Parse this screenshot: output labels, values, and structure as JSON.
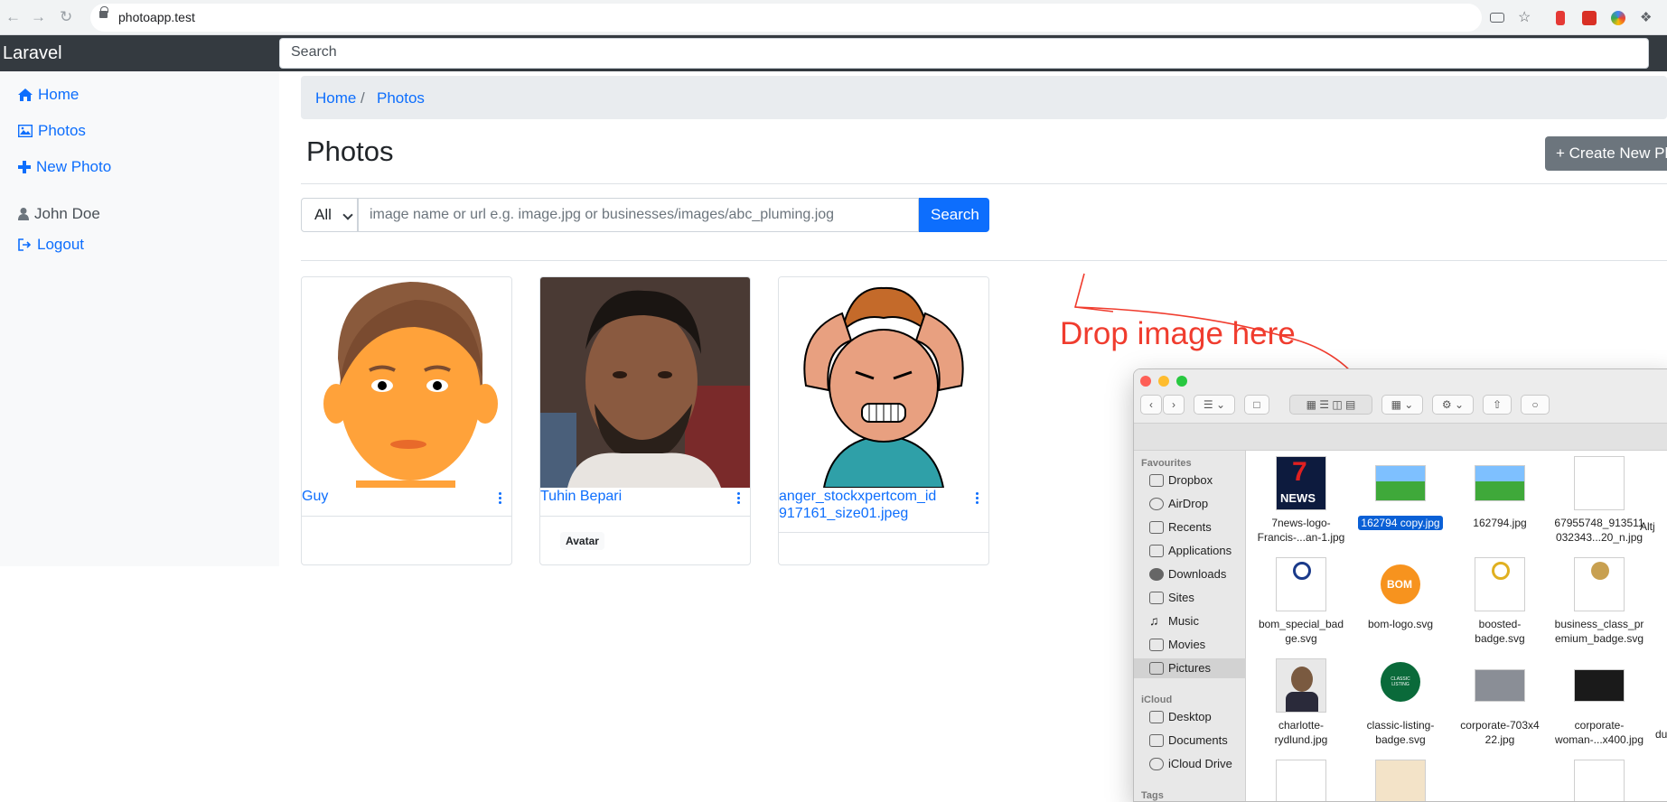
{
  "browser": {
    "url": "photoapp.test"
  },
  "navbar": {
    "brand": "Laravel",
    "search_placeholder": "Search"
  },
  "sidebar": {
    "items": [
      {
        "label": "Home",
        "icon": "home-icon"
      },
      {
        "label": "Photos",
        "icon": "image-icon"
      },
      {
        "label": "New Photo",
        "icon": "plus-icon"
      }
    ],
    "user": "John Doe",
    "logout": "Logout"
  },
  "breadcrumb": {
    "home": "Home",
    "sep": "/",
    "current": "Photos"
  },
  "page": {
    "title": "Photos",
    "create_button": "+ Create New Ph"
  },
  "filter": {
    "type_value": "All",
    "query_placeholder": "image name or url e.g. image.jpg or businesses/images/abc_pluming.jog",
    "search_button": "Search"
  },
  "cards": [
    {
      "name": "Guy",
      "badge": ""
    },
    {
      "name": "Tuhin Bepari",
      "badge": "Avatar"
    },
    {
      "name_line1": "anger_stockxpertcom_id",
      "name_line2": "917161_size01.jpeg",
      "badge": ""
    }
  ],
  "annotation": {
    "drop_text": "Drop image here",
    "color": "#f03c2e"
  },
  "finder": {
    "sidebar": {
      "favourites_header": "Favourites",
      "favourites": [
        "Dropbox",
        "AirDrop",
        "Recents",
        "Applications",
        "Downloads",
        "Sites",
        "Music",
        "Movies",
        "Pictures"
      ],
      "icloud_header": "iCloud",
      "icloud": [
        "Desktop",
        "Documents",
        "iCloud Drive"
      ],
      "tags_header": "Tags"
    },
    "files": [
      {
        "l1": "7news-logo-",
        "l2": "Francis-...an-1.jpg"
      },
      {
        "l1": "162794 copy.jpg",
        "l2": ""
      },
      {
        "l1": "162794.jpg",
        "l2": ""
      },
      {
        "l1": "67955748_913511",
        "l2": "032343...20_n.jpg"
      },
      {
        "l1": "Altj",
        "l2": ""
      },
      {
        "l1": "bom_special_bad",
        "l2": "ge.svg"
      },
      {
        "l1": "bom-logo.svg",
        "l2": ""
      },
      {
        "l1": "boosted-",
        "l2": "badge.svg"
      },
      {
        "l1": "business_class_pr",
        "l2": "emium_badge.svg"
      },
      {
        "l1": "charlotte-",
        "l2": "rydlund.jpg"
      },
      {
        "l1": "classic-listing-",
        "l2": "badge.svg"
      },
      {
        "l1": "corporate-703x4",
        "l2": "22.jpg"
      },
      {
        "l1": "corporate-",
        "l2": "woman-...x400.jpg"
      },
      {
        "l1": "du",
        "l2": ""
      }
    ],
    "thumb_texts": {
      "news": "NEWS",
      "seven": "7",
      "bom": "BOM",
      "classic": "CLASSIC LISTING"
    }
  }
}
